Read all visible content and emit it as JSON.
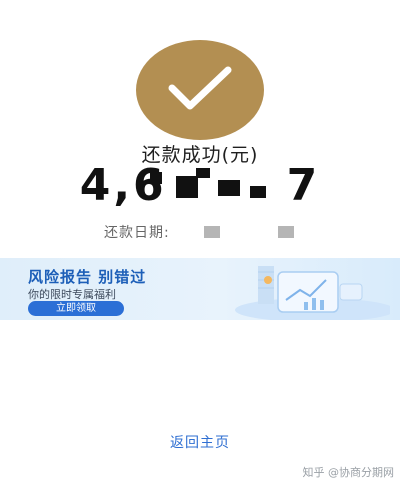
{
  "status": {
    "title": "还款成功(元)",
    "amount_prefix": "4,6",
    "amount_suffix": "7"
  },
  "date": {
    "label": "还款日期:"
  },
  "banner": {
    "title": "风险报告 别错过",
    "subtitle": "你的限时专属福利",
    "button_label": "立即领取"
  },
  "footer": {
    "back_home_label": "返回主页",
    "watermark": "知乎 @协商分期网"
  },
  "colors": {
    "accent_gold": "#b38f52",
    "link_blue": "#2f6fd2",
    "button_blue": "#2b6fd6"
  },
  "icons": {
    "success": "check-icon"
  }
}
